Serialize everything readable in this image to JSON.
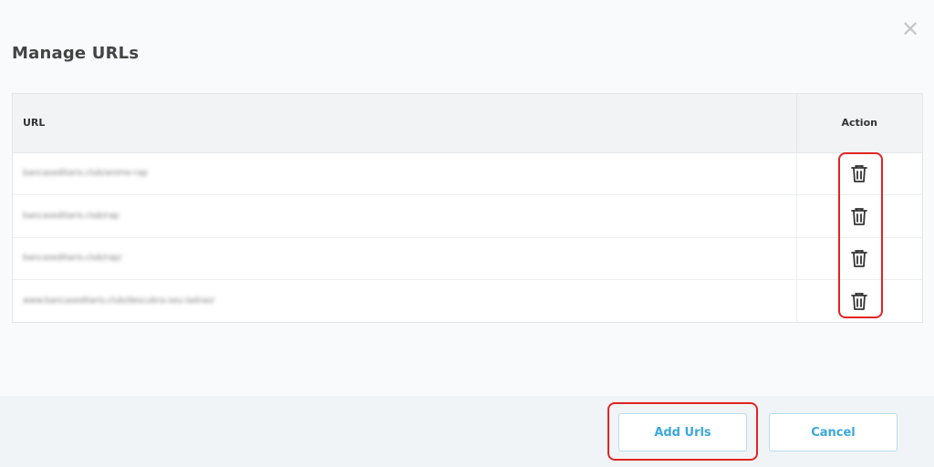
{
  "dialog": {
    "title": "Manage URLs",
    "close_glyph": "✕"
  },
  "table": {
    "headers": {
      "url": "URL",
      "action": "Action"
    },
    "rows": [
      {
        "url": "bancaseditaris.club/anime-rap"
      },
      {
        "url": "bancaseditaris.club/rap"
      },
      {
        "url": "bancaseditaris.club/rap/"
      },
      {
        "url": "www.bancaseditaris.club/descubra-seu-ladrao/"
      }
    ],
    "row_action_icon": "trash-icon"
  },
  "footer": {
    "add_label": "Add Urls",
    "cancel_label": "Cancel"
  },
  "colors": {
    "accent": "#3aa8db",
    "highlight": "#e02424",
    "title": "#444444"
  }
}
